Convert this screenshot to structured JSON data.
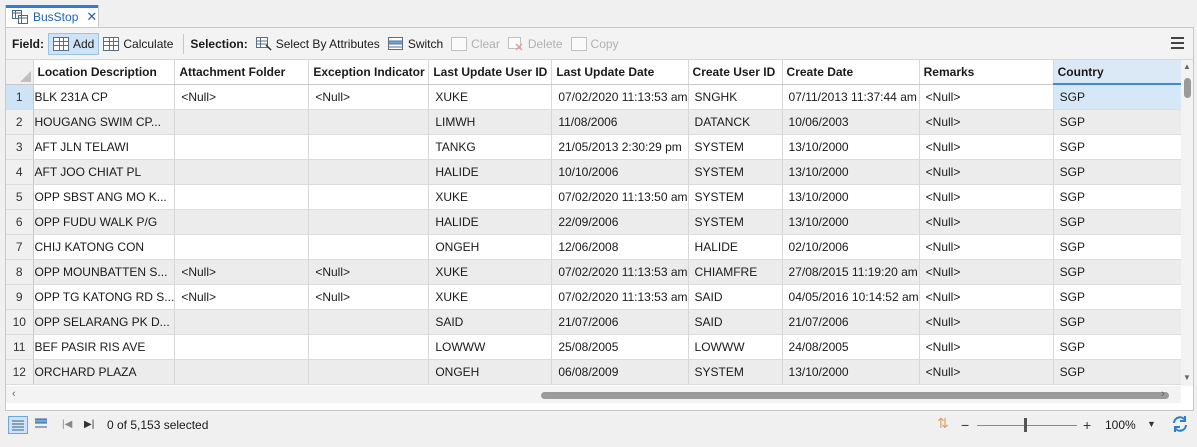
{
  "tab": {
    "title": "BusStop",
    "close": "✕"
  },
  "toolbar": {
    "field_label": "Field:",
    "add_label": "Add",
    "calculate_label": "Calculate",
    "selection_label": "Selection:",
    "select_by_attributes_label": "Select By Attributes",
    "switch_label": "Switch",
    "clear_label": "Clear",
    "delete_label": "Delete",
    "copy_label": "Copy"
  },
  "table": {
    "columns": [
      "Location Description",
      "Attachment Folder",
      "Exception Indicator",
      "Last Update User ID",
      "Last Update Date",
      "Create User ID",
      "Create Date",
      "Remarks",
      "Country"
    ],
    "rows": [
      {
        "num": "1",
        "cells": [
          "BLK 231A CP",
          "<Null>",
          "<Null>",
          "XUKE",
          "07/02/2020 11:13:53 am",
          "SNGHK",
          "07/11/2013 11:37:44 am",
          "<Null>",
          "SGP"
        ]
      },
      {
        "num": "2",
        "cells": [
          "HOUGANG SWIM CP...",
          "",
          "",
          "LIMWH",
          "11/08/2006",
          "DATANCK",
          "10/06/2003",
          "<Null>",
          "SGP"
        ]
      },
      {
        "num": "3",
        "cells": [
          "AFT JLN TELAWI",
          "",
          "",
          "TANKG",
          "21/05/2013 2:30:29 pm",
          "SYSTEM",
          "13/10/2000",
          "<Null>",
          "SGP"
        ]
      },
      {
        "num": "4",
        "cells": [
          "AFT JOO CHIAT PL",
          "",
          "",
          "HALIDE",
          "10/10/2006",
          "SYSTEM",
          "13/10/2000",
          "<Null>",
          "SGP"
        ]
      },
      {
        "num": "5",
        "cells": [
          "OPP SBST ANG MO K...",
          "",
          "",
          "XUKE",
          "07/02/2020 11:13:50 am",
          "SYSTEM",
          "13/10/2000",
          "<Null>",
          "SGP"
        ]
      },
      {
        "num": "6",
        "cells": [
          "OPP FUDU WALK P/G",
          "",
          "",
          "HALIDE",
          "22/09/2006",
          "SYSTEM",
          "13/10/2000",
          "<Null>",
          "SGP"
        ]
      },
      {
        "num": "7",
        "cells": [
          "CHIJ KATONG CON",
          "",
          "",
          "ONGEH",
          "12/06/2008",
          "HALIDE",
          "02/10/2006",
          "<Null>",
          "SGP"
        ]
      },
      {
        "num": "8",
        "cells": [
          "OPP MOUNBATTEN S...",
          "<Null>",
          "<Null>",
          "XUKE",
          "07/02/2020 11:13:53 am",
          "CHIAMFRE",
          "27/08/2015 11:19:20 am",
          "<Null>",
          "SGP"
        ]
      },
      {
        "num": "9",
        "cells": [
          "OPP TG KATONG RD S...",
          "<Null>",
          "<Null>",
          "XUKE",
          "07/02/2020 11:13:53 am",
          "SAID",
          "04/05/2016 10:14:52 am",
          "<Null>",
          "SGP"
        ]
      },
      {
        "num": "10",
        "cells": [
          "OPP SELARANG PK D...",
          "",
          "",
          "SAID",
          "21/07/2006",
          "SAID",
          "21/07/2006",
          "<Null>",
          "SGP"
        ]
      },
      {
        "num": "11",
        "cells": [
          "BEF PASIR RIS AVE",
          "",
          "",
          "LOWWW",
          "25/08/2005",
          "LOWWW",
          "24/08/2005",
          "<Null>",
          "SGP"
        ]
      },
      {
        "num": "12",
        "cells": [
          "ORCHARD PLAZA",
          "",
          "",
          "ONGEH",
          "06/08/2009",
          "SYSTEM",
          "13/10/2000",
          "<Null>",
          "SGP"
        ]
      }
    ]
  },
  "status": {
    "selected_text": "0 of 5,153 selected",
    "zoom": "100%",
    "zoom_minus": "−",
    "zoom_plus": "+"
  }
}
